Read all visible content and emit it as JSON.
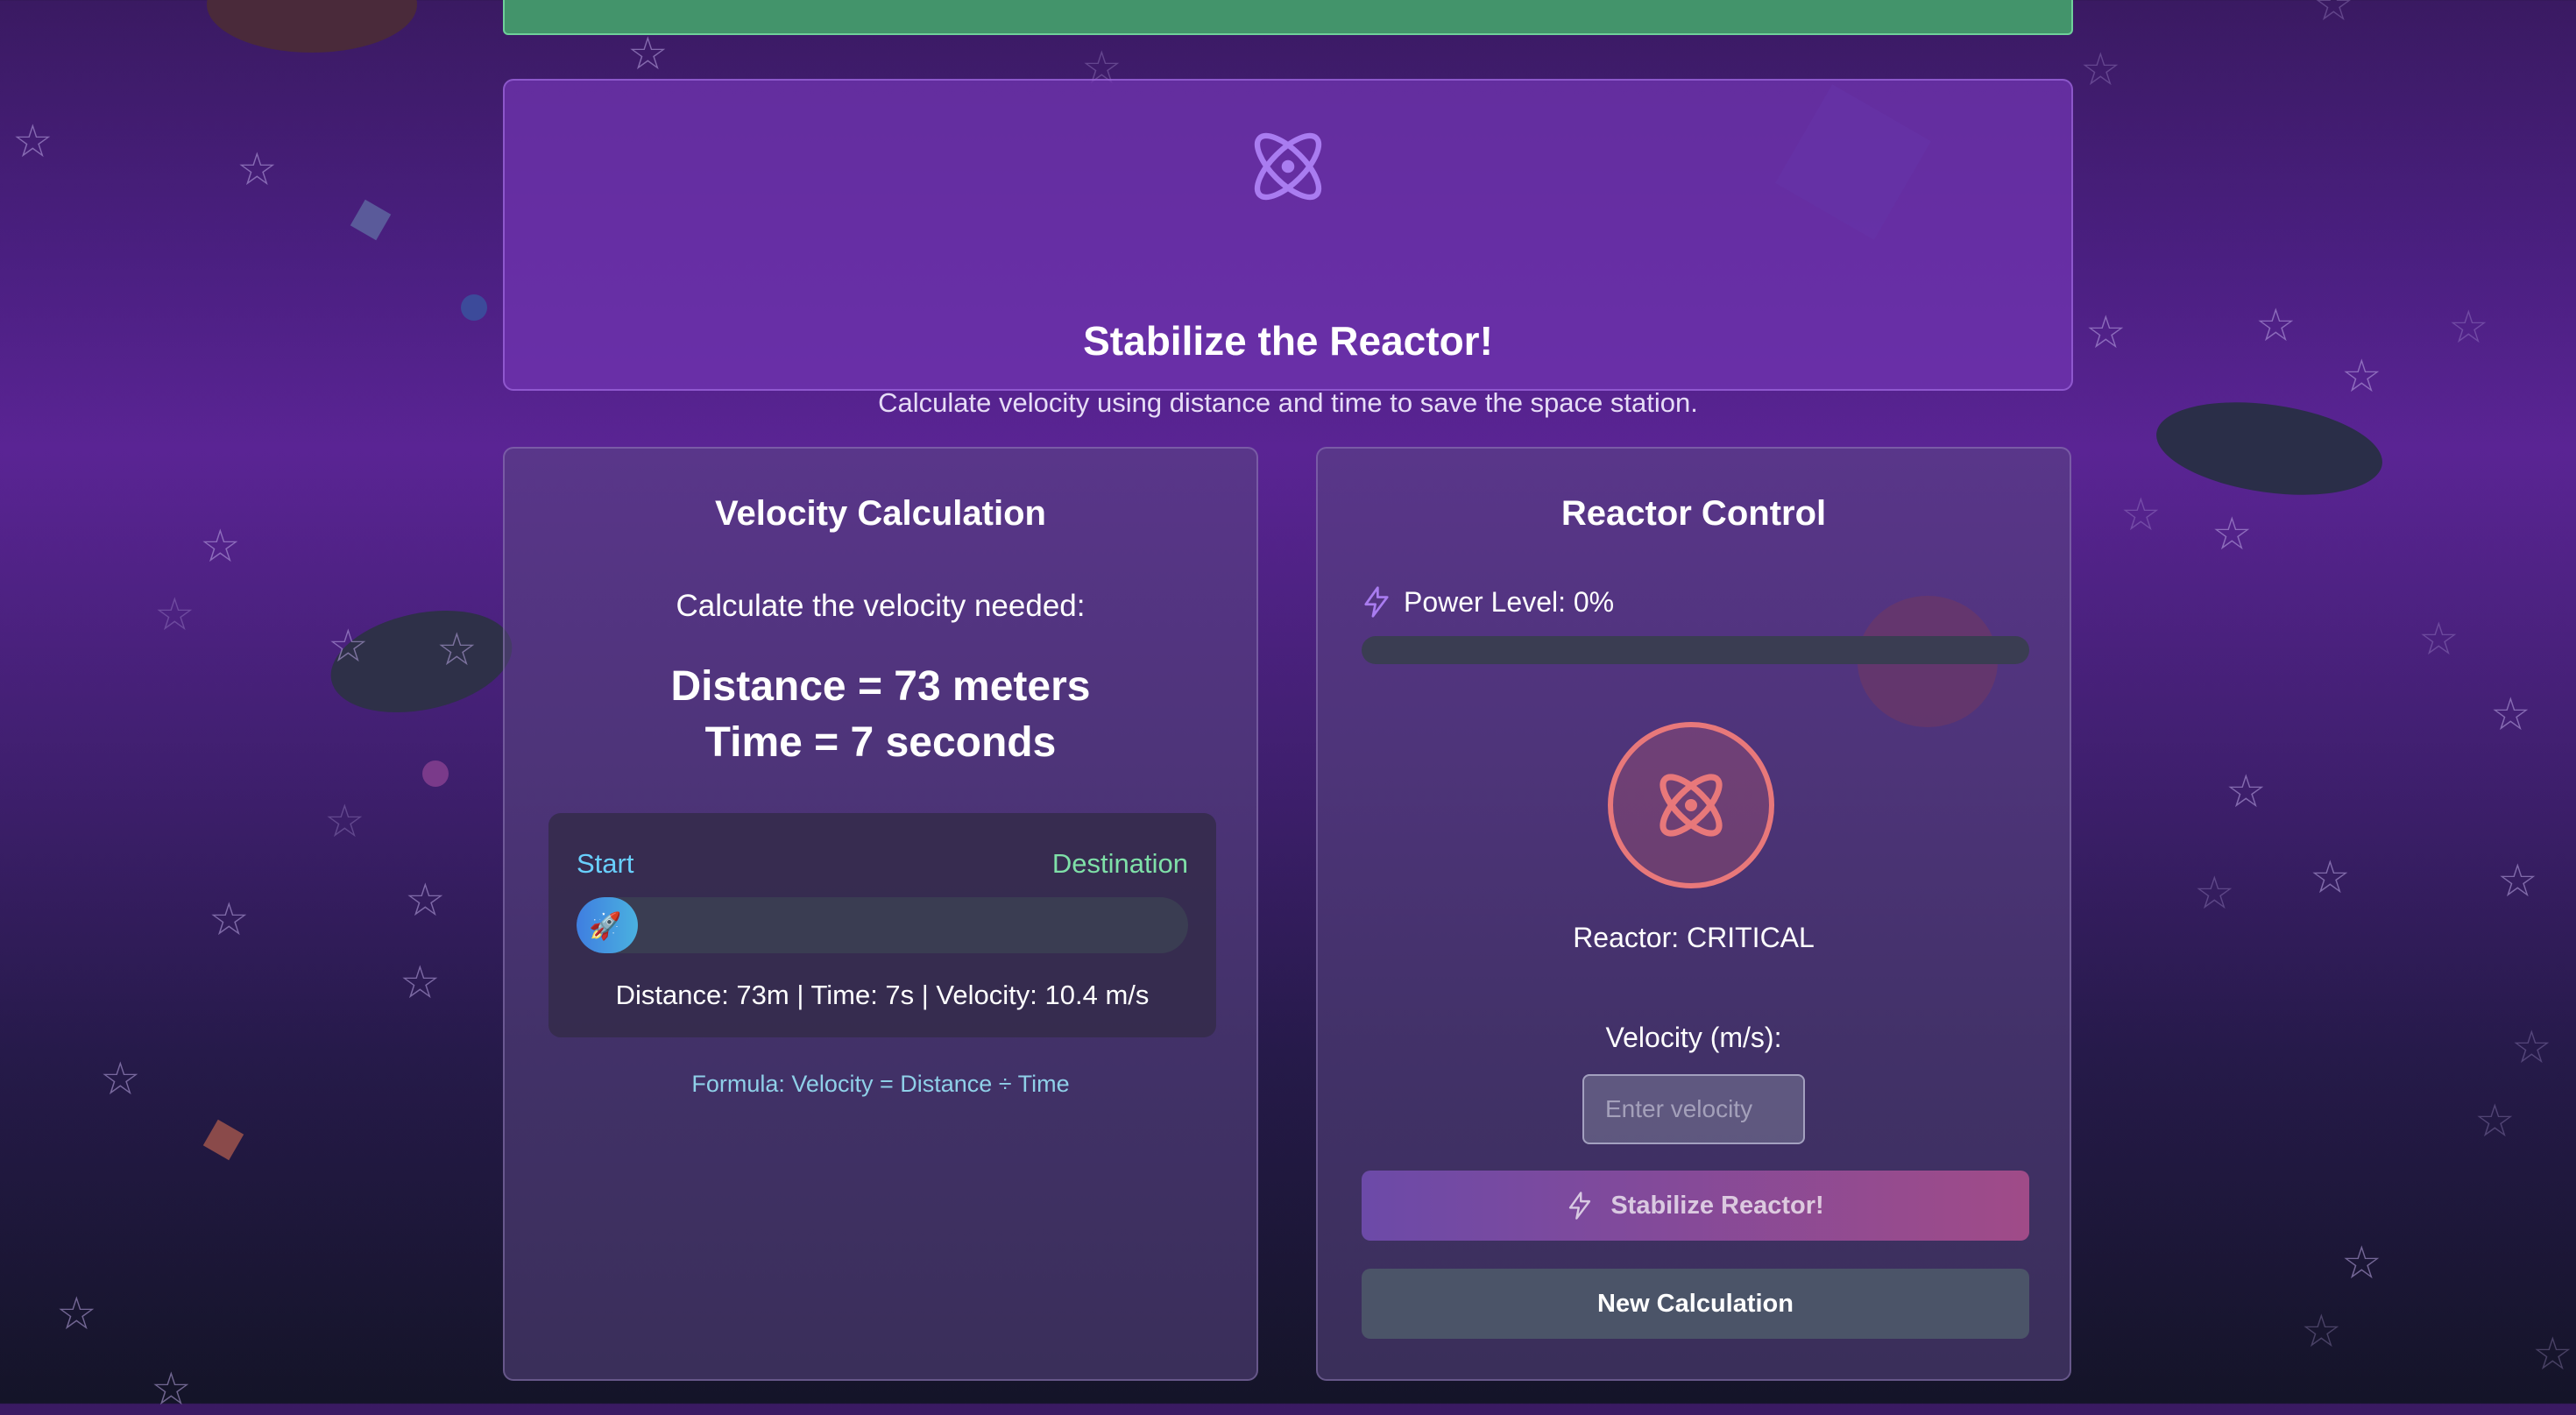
{
  "header": {
    "title": "Stabilize the Reactor!",
    "subtitle": "Calculate velocity using distance and time to save the space station."
  },
  "velocity_panel": {
    "title": "Velocity Calculation",
    "prompt": "Calculate the velocity needed:",
    "distance_line": "Distance = 73 meters",
    "time_line": "Time = 7 seconds",
    "track": {
      "start_label": "Start",
      "destination_label": "Destination",
      "progress_fraction": 0.1,
      "rocket_icon": "rocket-icon",
      "info": "Distance: 73m | Time: 7s | Velocity: 10.4 m/s"
    },
    "formula": "Formula: Velocity = Distance ÷ Time"
  },
  "reactor_panel": {
    "title": "Reactor Control",
    "power_label": "Power Level: 0%",
    "power_level_fraction": 0,
    "status": "Reactor: CRITICAL",
    "velocity_label": "Velocity (m/s):",
    "velocity_placeholder": "Enter velocity",
    "velocity_value": "",
    "stabilize_button": "Stabilize Reactor!",
    "new_calc_button": "New Calculation"
  },
  "colors": {
    "accent": "#a97cf0",
    "critical": "#e8787a",
    "top_bar": "#43946b"
  }
}
